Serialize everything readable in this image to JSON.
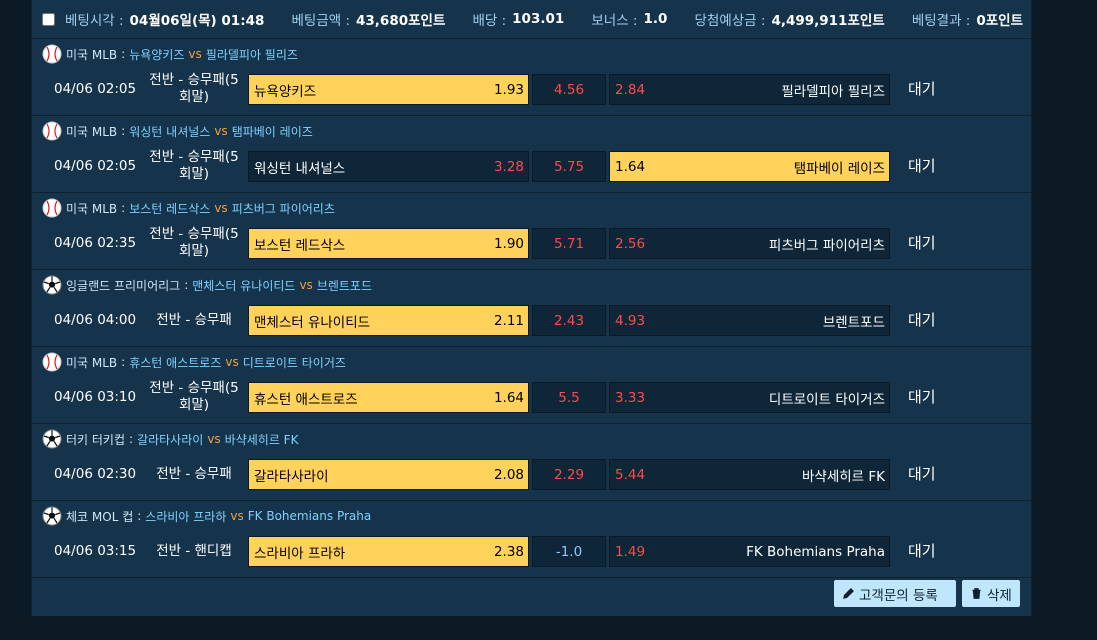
{
  "summary": {
    "time_label": "베팅시각 :",
    "time_value": "04월06일(목) 01:48",
    "amount_label": "베팅금액 :",
    "amount_value": "43,680포인트",
    "odds_label": "배당 :",
    "odds_value": "103.01",
    "bonus_label": "보너스 :",
    "bonus_value": "1.0",
    "expected_label": "당첨예상금 :",
    "expected_value": "4,499,911포인트",
    "result_label": "베팅결과 :",
    "result_value": "0포인트"
  },
  "games": [
    {
      "icon": "baseball-icon",
      "league": "미국 MLB",
      "home": "뉴욕양키즈",
      "away": "필라델피아 필리즈",
      "time": "04/06 02:05",
      "market": "전반 - 승무패(5회말)",
      "home_odds": "1.93",
      "draw_odds": "4.56",
      "away_odds": "2.84",
      "selected": "home",
      "draw_blue": false,
      "status": "대기"
    },
    {
      "icon": "baseball-icon",
      "league": "미국 MLB",
      "home": "워싱턴 내셔널스",
      "away": "탬파베이 레이즈",
      "time": "04/06 02:05",
      "market": "전반 - 승무패(5회말)",
      "home_odds": "3.28",
      "draw_odds": "5.75",
      "away_odds": "1.64",
      "selected": "away",
      "draw_blue": false,
      "status": "대기"
    },
    {
      "icon": "baseball-icon",
      "league": "미국 MLB",
      "home": "보스턴 레드삭스",
      "away": "피츠버그 파이어리츠",
      "time": "04/06 02:35",
      "market": "전반 - 승무패(5회말)",
      "home_odds": "1.90",
      "draw_odds": "5.71",
      "away_odds": "2.56",
      "selected": "home",
      "draw_blue": false,
      "status": "대기"
    },
    {
      "icon": "soccer-ball-icon",
      "league": "잉글랜드 프리미어리그",
      "home": "맨체스터 유나이티드",
      "away": "브렌트포드",
      "time": "04/06 04:00",
      "market": "전반 - 승무패",
      "home_odds": "2.11",
      "draw_odds": "2.43",
      "away_odds": "4.93",
      "selected": "home",
      "draw_blue": false,
      "status": "대기"
    },
    {
      "icon": "baseball-icon",
      "league": "미국 MLB",
      "home": "휴스턴 애스트로즈",
      "away": "디트로이트 타이거즈",
      "time": "04/06 03:10",
      "market": "전반 - 승무패(5회말)",
      "home_odds": "1.64",
      "draw_odds": "5.5",
      "away_odds": "3.33",
      "selected": "home",
      "draw_blue": false,
      "status": "대기"
    },
    {
      "icon": "soccer-ball-icon",
      "league": "터키 터키컵",
      "home": "갈라타사라이",
      "away": "바샥세히르 FK",
      "time": "04/06 02:30",
      "market": "전반 - 승무패",
      "home_odds": "2.08",
      "draw_odds": "2.29",
      "away_odds": "5.44",
      "selected": "home",
      "draw_blue": false,
      "status": "대기"
    },
    {
      "icon": "soccer-ball-icon",
      "league": "체코 MOL 컵",
      "home": "스라비아 프라하",
      "away": "FK Bohemians Praha",
      "time": "04/06 03:15",
      "market": "전반 - 핸디캡",
      "home_odds": "2.38",
      "draw_odds": "-1.0",
      "away_odds": "1.49",
      "selected": "home",
      "draw_blue": true,
      "status": "대기"
    }
  ],
  "footer": {
    "register_label": "고객문의 등록",
    "delete_label": "삭제"
  },
  "colors": {
    "panel": "#15334b",
    "selected": "#ffd25c",
    "odds_red": "#ff4a4a",
    "vs_orange": "#f2a33a",
    "team_blue": "#7fd1ff"
  }
}
